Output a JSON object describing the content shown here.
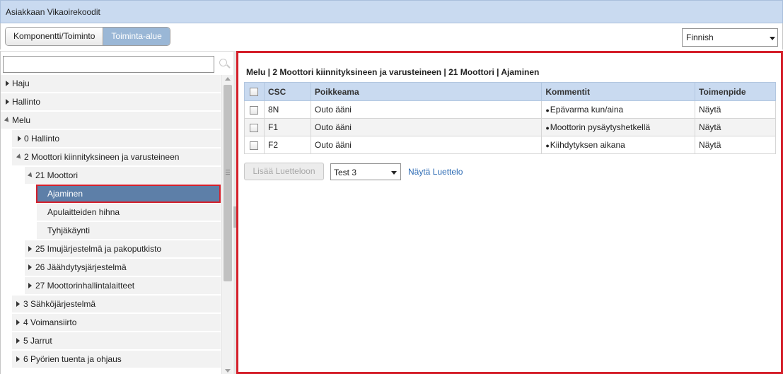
{
  "window": {
    "title": "Asiakkaan Vikaoirekoodit"
  },
  "toolbar": {
    "tabs": [
      {
        "label": "Komponentti/Toiminto"
      },
      {
        "label": "Toiminta-alue"
      }
    ],
    "active_tab": "Toiminta-alue",
    "language": {
      "value": "Finnish"
    }
  },
  "sidebar": {
    "search": {
      "value": "",
      "placeholder": ""
    },
    "tree": [
      {
        "label": "Haju"
      },
      {
        "label": "Hallinto"
      },
      {
        "label": "Melu"
      },
      {
        "label": "0 Hallinto"
      },
      {
        "label": "2 Moottori kiinnityksineen ja varusteineen"
      },
      {
        "label": "21 Moottori"
      },
      {
        "label": "Ajaminen"
      },
      {
        "label": "Apulaitteiden hihna"
      },
      {
        "label": "Tyhjäkäynti"
      },
      {
        "label": "25 Imujärjestelmä ja pakoputkisto"
      },
      {
        "label": "26 Jäähdytysjärjestelmä"
      },
      {
        "label": "27 Moottorinhallintalaitteet"
      },
      {
        "label": "3 Sähköjärjestelmä"
      },
      {
        "label": "4 Voimansiirto"
      },
      {
        "label": "5 Jarrut"
      },
      {
        "label": "6 Pyörien tuenta ja ohjaus"
      }
    ],
    "selected": "Ajaminen"
  },
  "main": {
    "breadcrumb": "Melu | 2 Moottori kiinnityksineen ja varusteineen | 21 Moottori | Ajaminen",
    "table": {
      "headers": {
        "csc": "CSC",
        "poikkeama": "Poikkeama",
        "kommentit": "Kommentit",
        "toimenpide": "Toimenpide"
      },
      "rows": [
        {
          "csc": "8N",
          "poikkeama": "Outo ääni",
          "kommentit": "Epävarma kun/aina",
          "toimenpide": "Näytä"
        },
        {
          "csc": "F1",
          "poikkeama": "Outo ääni",
          "kommentit": "Moottorin pysäytyshetkellä",
          "toimenpide": "Näytä"
        },
        {
          "csc": "F2",
          "poikkeama": "Outo ääni",
          "kommentit": "Kiihdytyksen aikana",
          "toimenpide": "Näytä"
        }
      ]
    },
    "actions": {
      "add_label": "Lisää Luetteloon",
      "list_value": "Test 3",
      "show_label": "Näytä Luettelo"
    }
  },
  "colors": {
    "header_bg": "#c9daf0",
    "selected_bg": "#5d7fa8",
    "highlight_border": "#d41f2a",
    "link": "#2f6db5"
  }
}
